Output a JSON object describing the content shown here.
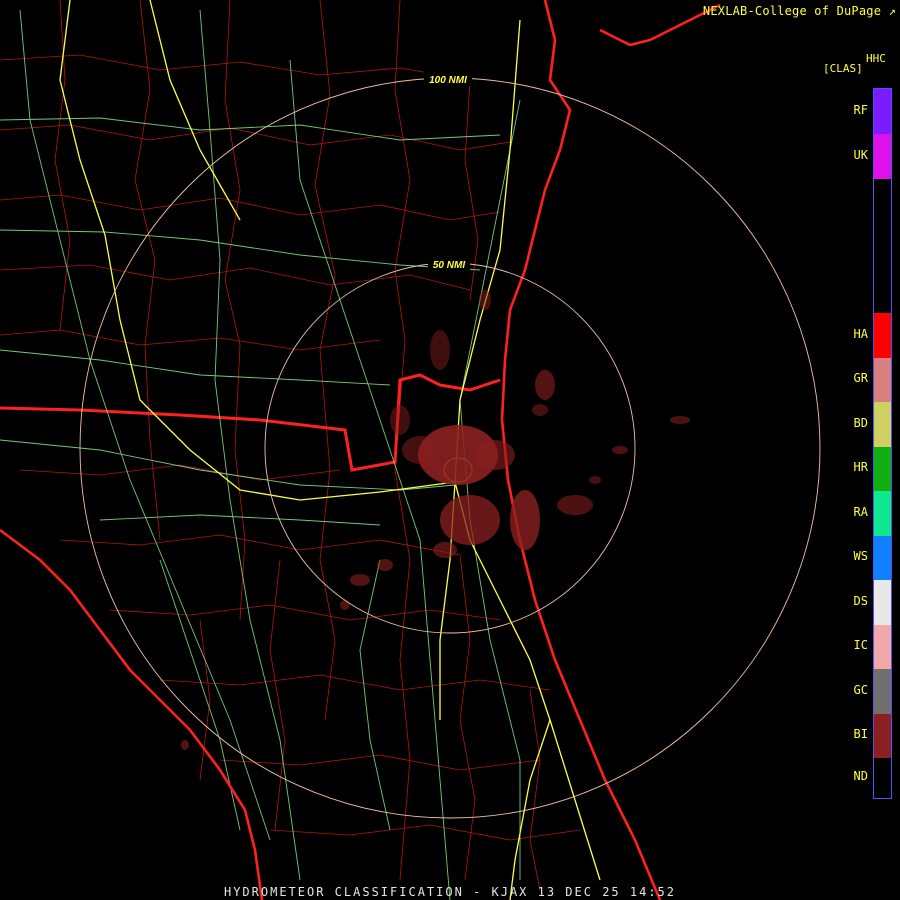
{
  "header": {
    "credit": "NEXLAB-College of DuPage",
    "credit_icon": "external-link-icon",
    "product_code": "HHC",
    "product_class": "[CLAS]"
  },
  "footer": {
    "caption": "HYDROMETEOR CLASSIFICATION - KJAX 13 DEC 25 14:52"
  },
  "range_rings": {
    "outer_label": "100 NMI",
    "inner_label": "50 NMI"
  },
  "legend": {
    "items": [
      {
        "code": "RF",
        "color": "#7b1cff"
      },
      {
        "code": "UK",
        "color": "#e010e8"
      },
      {
        "code": "HA",
        "color": "#ff0000"
      },
      {
        "code": "GR",
        "color": "#d88080"
      },
      {
        "code": "BD",
        "color": "#d0d060"
      },
      {
        "code": "HR",
        "color": "#10b010"
      },
      {
        "code": "RA",
        "color": "#10e890"
      },
      {
        "code": "WS",
        "color": "#1080ff"
      },
      {
        "code": "DS",
        "color": "#e8e8e8"
      },
      {
        "code": "IC",
        "color": "#f0a8a8"
      },
      {
        "code": "GC",
        "color": "#707070"
      },
      {
        "code": "BI",
        "color": "#8b2020"
      },
      {
        "code": "ND",
        "color": "#000000"
      }
    ]
  },
  "colors": {
    "coastline": "#ff2020",
    "county_border": "#c01818",
    "interstate": "#ffff40",
    "highway": "#80e080",
    "range_ring": "#f0c0a0",
    "echo": "#8b2020"
  }
}
